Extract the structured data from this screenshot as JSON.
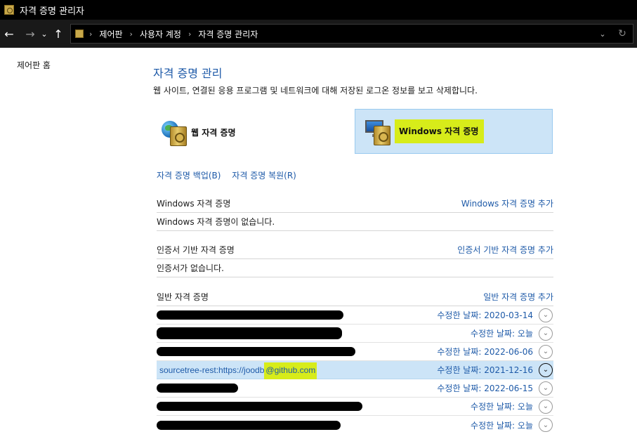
{
  "window": {
    "title": "자격 증명 관리자"
  },
  "breadcrumb": [
    "제어판",
    "사용자 계정",
    "자격 증명 관리자"
  ],
  "left_pane": {
    "home_link": "제어판 홈"
  },
  "main": {
    "heading": "자격 증명 관리",
    "subtitle": "웹 사이트, 연결된 응용 프로그램 및 네트워크에 대해 저장된 로그온 정보를 보고 삭제합니다.",
    "vaults": {
      "web": {
        "label": "웹 자격 증명",
        "selected": false
      },
      "windows": {
        "label": "Windows 자격 증명",
        "selected": true
      }
    },
    "actions": {
      "backup": "자격 증명 백업(B)",
      "restore": "자격 증명 복원(R)"
    },
    "sections": {
      "windows": {
        "title": "Windows 자격 증명",
        "add": "Windows 자격 증명 추가",
        "empty": "Windows 자격 증명이 없습니다."
      },
      "certificate": {
        "title": "인증서 기반 자격 증명",
        "add": "인증서 기반 자격 증명 추가",
        "empty": "인증서가 없습니다."
      },
      "generic": {
        "title": "일반 자격 증명",
        "add": "일반 자격 증명 추가",
        "items": [
          {
            "name": "",
            "modified": "수정한 날짜:  2020-03-14",
            "redacted": true,
            "selected": false
          },
          {
            "name": "",
            "modified": "수정한 날짜:  오늘",
            "redacted": true,
            "selected": false
          },
          {
            "name": "",
            "modified": "수정한 날짜:  2022-06-06",
            "redacted": true,
            "selected": false
          },
          {
            "name_prefix": "sourcetree-rest:https://joodb",
            "name_highlight": "@github.com",
            "modified": "수정한 날짜:  2021-12-16",
            "redacted": false,
            "selected": true
          },
          {
            "name": "",
            "modified": "수정한 날짜:  2022-06-15",
            "redacted": true,
            "selected": false
          },
          {
            "name": "",
            "modified": "수정한 날짜:  오늘",
            "redacted": true,
            "selected": false
          },
          {
            "name": "",
            "modified": "수정한 날짜:  오늘",
            "redacted": true,
            "selected": false
          }
        ]
      }
    }
  },
  "colors": {
    "link": "#1e5aa8",
    "highlight": "#d7ec1a",
    "selection": "#cce4f7"
  }
}
